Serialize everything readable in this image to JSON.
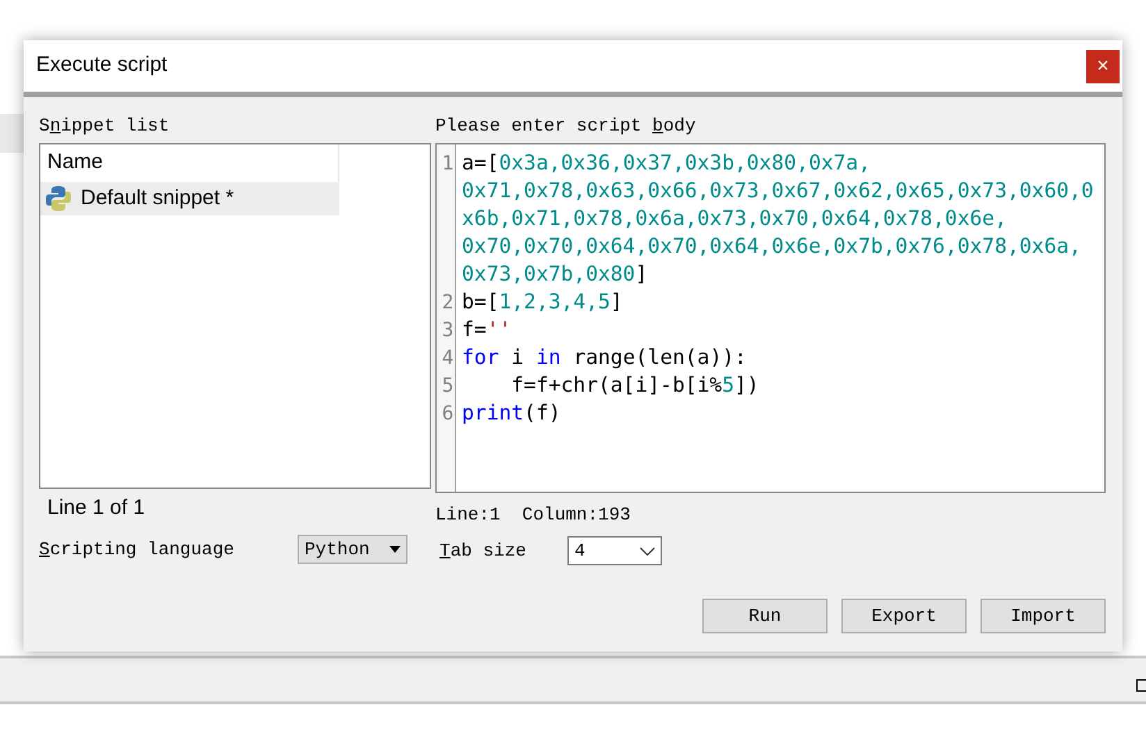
{
  "window": {
    "title": "Execute script",
    "close": "×"
  },
  "snippets": {
    "label": {
      "pre": "S",
      "key": "n",
      "post": "ippet list"
    },
    "column": "Name",
    "items": [
      {
        "name": "Default snippet *",
        "selected": true
      }
    ],
    "position": "Line 1 of 1"
  },
  "language": {
    "label": {
      "key": "S",
      "post": "cripting language"
    },
    "value": "Python"
  },
  "editor": {
    "label": {
      "pre": "Please enter script ",
      "key": "b",
      "post": "ody"
    },
    "lines": [
      {
        "number": "1",
        "rows": [
          [
            {
              "kind": "plain",
              "text": "a=["
            },
            {
              "kind": "number",
              "text": "0x3a,0x36,0x37,0x3b,0x80,0x7a,"
            }
          ],
          [
            {
              "kind": "number",
              "text": "0x71,0x78,0x63,0x66,0x73,0x67,0x62,0x65,0x73,0x60,0"
            }
          ],
          [
            {
              "kind": "number",
              "text": "x6b,0x71,0x78,0x6a,0x73,0x70,0x64,0x78,0x6e,"
            }
          ],
          [
            {
              "kind": "number",
              "text": "0x70,0x70,0x64,0x70,0x64,0x6e,0x7b,0x76,0x78,0x6a,"
            }
          ],
          [
            {
              "kind": "number",
              "text": "0x73,0x7b,0x80"
            },
            {
              "kind": "plain",
              "text": "]"
            }
          ]
        ]
      },
      {
        "number": "2",
        "rows": [
          [
            {
              "kind": "plain",
              "text": "b=["
            },
            {
              "kind": "number",
              "text": "1,2,3,4,5"
            },
            {
              "kind": "plain",
              "text": "]"
            }
          ]
        ]
      },
      {
        "number": "3",
        "rows": [
          [
            {
              "kind": "plain",
              "text": "f="
            },
            {
              "kind": "string",
              "text": "''"
            }
          ]
        ]
      },
      {
        "number": "4",
        "rows": [
          [
            {
              "kind": "keyword",
              "text": "for"
            },
            {
              "kind": "plain",
              "text": " i "
            },
            {
              "kind": "keyword",
              "text": "in"
            },
            {
              "kind": "plain",
              "text": " range(len(a)):"
            }
          ]
        ]
      },
      {
        "number": "5",
        "rows": [
          [
            {
              "kind": "plain",
              "text": "    f=f+chr(a[i]-b[i%"
            },
            {
              "kind": "number",
              "text": "5"
            },
            {
              "kind": "plain",
              "text": "])"
            }
          ]
        ]
      },
      {
        "number": "6",
        "rows": [
          [
            {
              "kind": "keyword",
              "text": "print"
            },
            {
              "kind": "plain",
              "text": "(f)"
            }
          ]
        ]
      }
    ],
    "cursor": "Line:1  Column:193"
  },
  "tab_size": {
    "label": {
      "key": "T",
      "post": "ab size"
    },
    "value": "4"
  },
  "buttons": [
    "Run",
    "Export",
    "Import"
  ]
}
